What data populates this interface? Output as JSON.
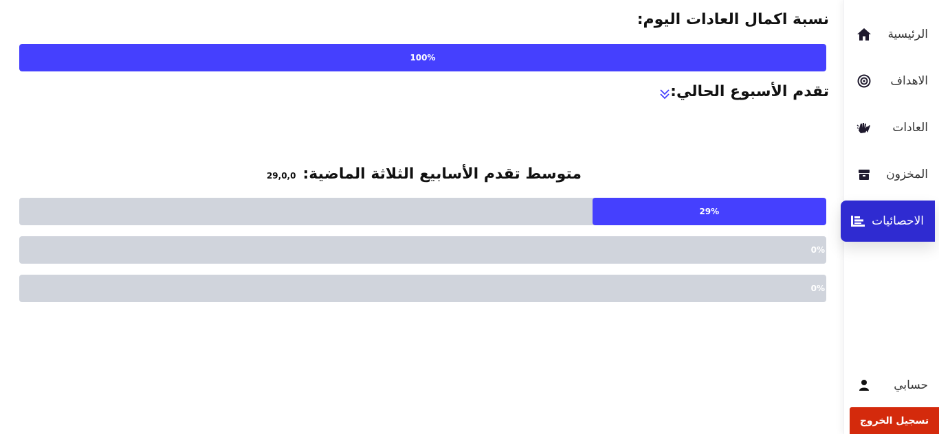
{
  "sidebar": {
    "items": [
      {
        "label": "الرئيسية",
        "icon": "home-icon"
      },
      {
        "label": "الاهداف",
        "icon": "target-icon"
      },
      {
        "label": "العادات",
        "icon": "hands-icon"
      },
      {
        "label": "المخزون",
        "icon": "box-icon"
      },
      {
        "label": "الاحصائيات",
        "icon": "stats-list-icon",
        "active": true
      }
    ],
    "account_label": "حسابي",
    "account_icon": "user-icon",
    "logout_label": "تسجيل الخروج"
  },
  "today": {
    "title": "نسبة اكمال العادات اليوم:",
    "progress": 100,
    "progress_label": "100%"
  },
  "week": {
    "title": "تقدم الأسبوع الحالي:",
    "toggle_icon": "chevron-double-down-icon"
  },
  "last_three_weeks": {
    "title": "متوسط تقدم الأسابيع الثلاثة الماضية:",
    "values_text": "29,0,0",
    "bars": [
      {
        "progress": 29,
        "label": "29%"
      },
      {
        "progress": 0,
        "label": "0%"
      },
      {
        "progress": 0,
        "label": "0%"
      }
    ]
  },
  "colors": {
    "accent": "#4540fe",
    "active_nav": "#2f2bd1",
    "track": "#d0d4dc",
    "logout": "#d42a0c"
  }
}
